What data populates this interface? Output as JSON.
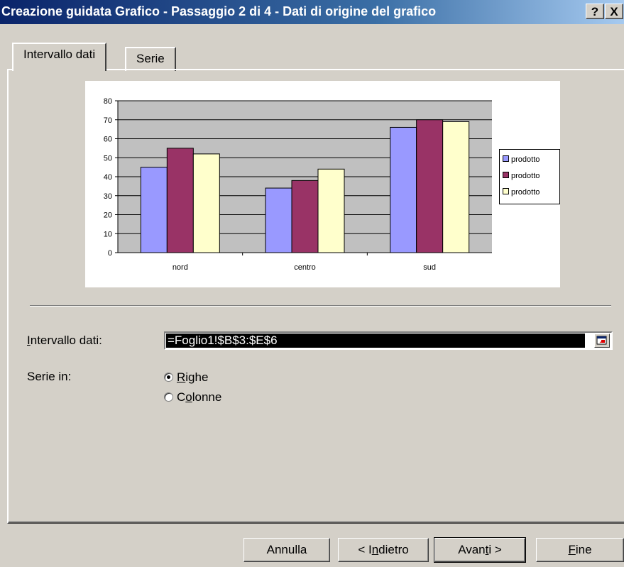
{
  "window": {
    "title": "Creazione guidata Grafico - Passaggio 2 di 4 - Dati di origine del grafico",
    "help_glyph": "?",
    "close_glyph": "X"
  },
  "tabs": [
    {
      "label": "Intervallo dati",
      "active": true
    },
    {
      "label": "Serie",
      "active": false
    }
  ],
  "form": {
    "range_label": "Intervallo dati:",
    "range_value": "=Foglio1!$B$3:$E$6",
    "series_in_label": "Serie in:",
    "options": [
      {
        "label": "Righe",
        "checked": true
      },
      {
        "label": "Colonne",
        "checked": false
      }
    ]
  },
  "buttons": {
    "cancel": "Annulla",
    "back": "< Indietro",
    "next": "Avanti >",
    "finish": "Fine"
  },
  "chart_data": {
    "type": "bar",
    "categories": [
      "nord",
      "centro",
      "sud"
    ],
    "series": [
      {
        "name": "prodotto",
        "values": [
          45,
          34,
          66
        ],
        "color": "#9999ff"
      },
      {
        "name": "prodotto",
        "values": [
          55,
          38,
          70
        ],
        "color": "#993366"
      },
      {
        "name": "prodotto",
        "values": [
          52,
          44,
          69
        ],
        "color": "#ffffcc"
      }
    ],
    "ylim": [
      0,
      80
    ],
    "yticks": [
      "0",
      "10",
      "20",
      "30",
      "40",
      "50",
      "60",
      "70",
      "80"
    ],
    "plot_background": "#c0c0c0",
    "grid": true,
    "legend": "right"
  }
}
